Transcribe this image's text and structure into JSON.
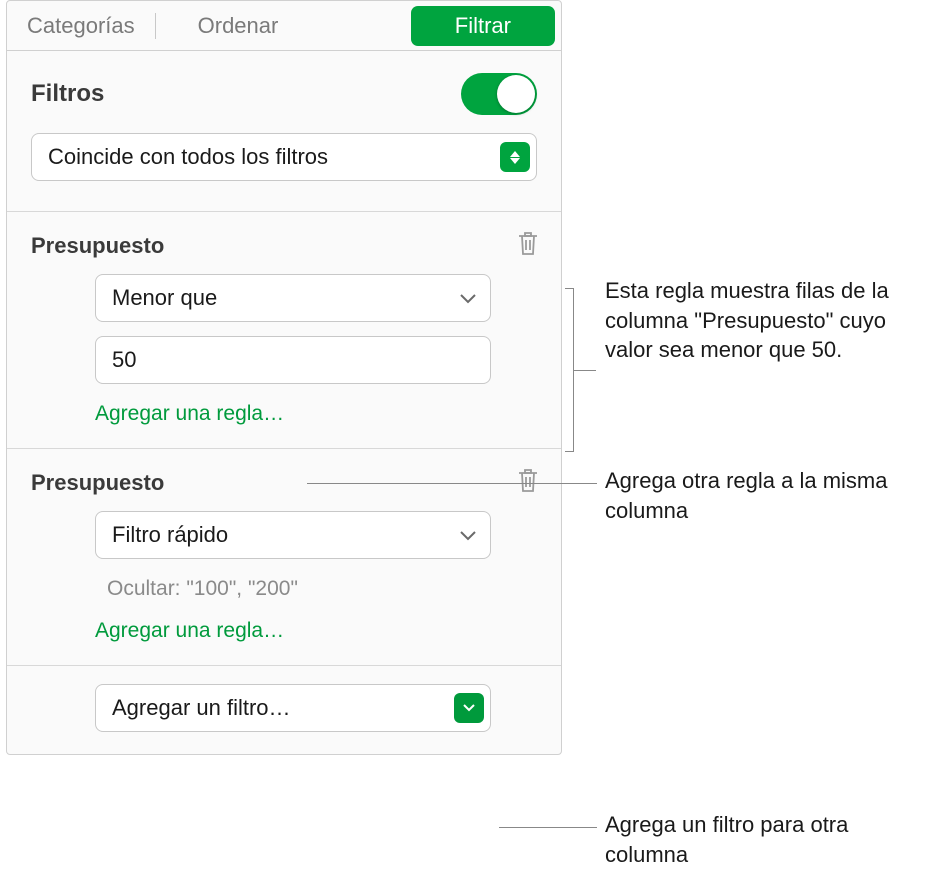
{
  "tabs": {
    "categorias": "Categorías",
    "ordenar": "Ordenar",
    "filtrar": "Filtrar"
  },
  "filters": {
    "title": "Filtros",
    "match_mode": "Coincide con todos los filtros",
    "groups": [
      {
        "column": "Presupuesto",
        "rule_type": "Menor que",
        "value": "50",
        "add_rule_label": "Agregar una regla…"
      },
      {
        "column": "Presupuesto",
        "rule_type": "Filtro rápido",
        "hide_text": "Ocultar: \"100\", \"200\"",
        "add_rule_label": "Agregar una regla…"
      }
    ],
    "add_filter_label": "Agregar un filtro…"
  },
  "callouts": {
    "c1": "Esta regla muestra filas de la columna \"Presupuesto\" cuyo valor sea menor que 50.",
    "c2": "Agrega otra regla a la misma columna",
    "c3": "Agrega un filtro para otra columna"
  }
}
